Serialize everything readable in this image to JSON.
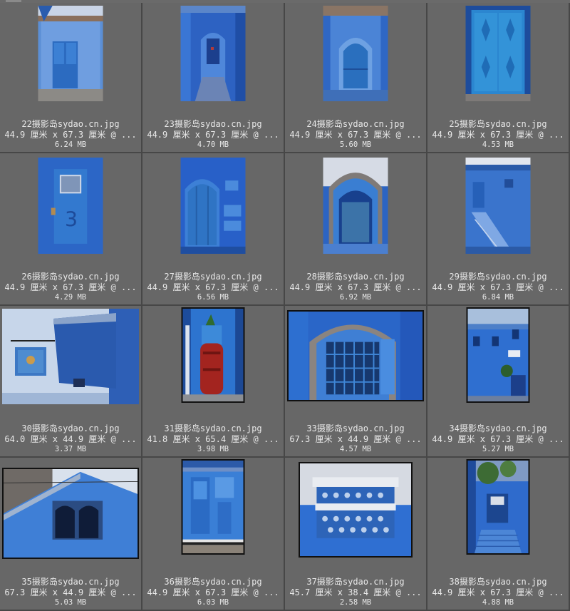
{
  "thumbnails": [
    {
      "name": "22摄影岛sydao.cn.jpg",
      "dims": "44.9 厘米 x 67.3 厘米 @ ...",
      "size": "6.24 MB",
      "subject": "blue-door-house",
      "orientation": "portrait"
    },
    {
      "name": "23摄影岛sydao.cn.jpg",
      "dims": "44.9 厘米 x 67.3 厘米 @ ...",
      "size": "4.70 MB",
      "subject": "blue-alley-arch",
      "orientation": "portrait"
    },
    {
      "name": "24摄影岛sydao.cn.jpg",
      "dims": "44.9 厘米 x 67.3 厘米 @ ...",
      "size": "5.60 MB",
      "subject": "arched-door",
      "orientation": "portrait"
    },
    {
      "name": "25摄影岛sydao.cn.jpg",
      "dims": "44.9 厘米 x 67.3 厘米 @ ...",
      "size": "4.53 MB",
      "subject": "diamond-door",
      "orientation": "portrait"
    },
    {
      "name": "26摄影岛sydao.cn.jpg",
      "dims": "44.9 厘米 x 67.3 厘米 @ ...",
      "size": "4.29 MB",
      "subject": "door-number-3",
      "orientation": "portrait"
    },
    {
      "name": "27摄影岛sydao.cn.jpg",
      "dims": "44.9 厘米 x 67.3 厘米 @ ...",
      "size": "6.56 MB",
      "subject": "arched-wooden-door",
      "orientation": "portrait"
    },
    {
      "name": "28摄影岛sydao.cn.jpg",
      "dims": "44.9 厘米 x 67.3 厘米 @ ...",
      "size": "6.92 MB",
      "subject": "old-arched-door",
      "orientation": "portrait"
    },
    {
      "name": "29摄影岛sydao.cn.jpg",
      "dims": "44.9 厘米 x 67.3 厘米 @ ...",
      "size": "6.84 MB",
      "subject": "blue-stairs",
      "orientation": "portrait"
    },
    {
      "name": "30摄影岛sydao.cn.jpg",
      "dims": "64.0 厘米 x 44.9 厘米 @ ...",
      "size": "3.37 MB",
      "subject": "hanging-sign",
      "orientation": "landscape"
    },
    {
      "name": "31摄影岛sydao.cn.jpg",
      "dims": "41.8 厘米 x 65.4 厘米 @ ...",
      "size": "3.98 MB",
      "subject": "red-pot",
      "orientation": "portrait"
    },
    {
      "name": "33摄影岛sydao.cn.jpg",
      "dims": "67.3 厘米 x 44.9 厘米 @ ...",
      "size": "4.57 MB",
      "subject": "grilled-window",
      "orientation": "landscape"
    },
    {
      "name": "34摄影岛sydao.cn.jpg",
      "dims": "44.9 厘米 x 67.3 厘米 @ ...",
      "size": "5.27 MB",
      "subject": "blue-street",
      "orientation": "portrait"
    },
    {
      "name": "35摄影岛sydao.cn.jpg",
      "dims": "67.3 厘米 x 44.9 厘米 @ ...",
      "size": "5.03 MB",
      "subject": "gable-window",
      "orientation": "landscape"
    },
    {
      "name": "36摄影岛sydao.cn.jpg",
      "dims": "44.9 厘米 x 67.3 厘米 @ ...",
      "size": "6.03 MB",
      "subject": "ornate-door",
      "orientation": "portrait"
    },
    {
      "name": "37摄影岛sydao.cn.jpg",
      "dims": "45.7 厘米 x 38.4 厘米 @ ...",
      "size": "2.58 MB",
      "subject": "lattice-window",
      "orientation": "landscape"
    },
    {
      "name": "38摄影岛sydao.cn.jpg",
      "dims": "44.9 厘米 x 67.3 厘米 @ ...",
      "size": "4.88 MB",
      "subject": "tree-and-steps",
      "orientation": "portrait"
    }
  ],
  "colors": {
    "panel": "#676767",
    "cell_border": "#474747",
    "caption_text": "#e8e8e8",
    "wall_light": "#5f8fd8",
    "wall_mid": "#2f63c0",
    "wall_dark": "#1b3f8e",
    "door": "#2a79c4",
    "pot_red": "#a3241f"
  }
}
